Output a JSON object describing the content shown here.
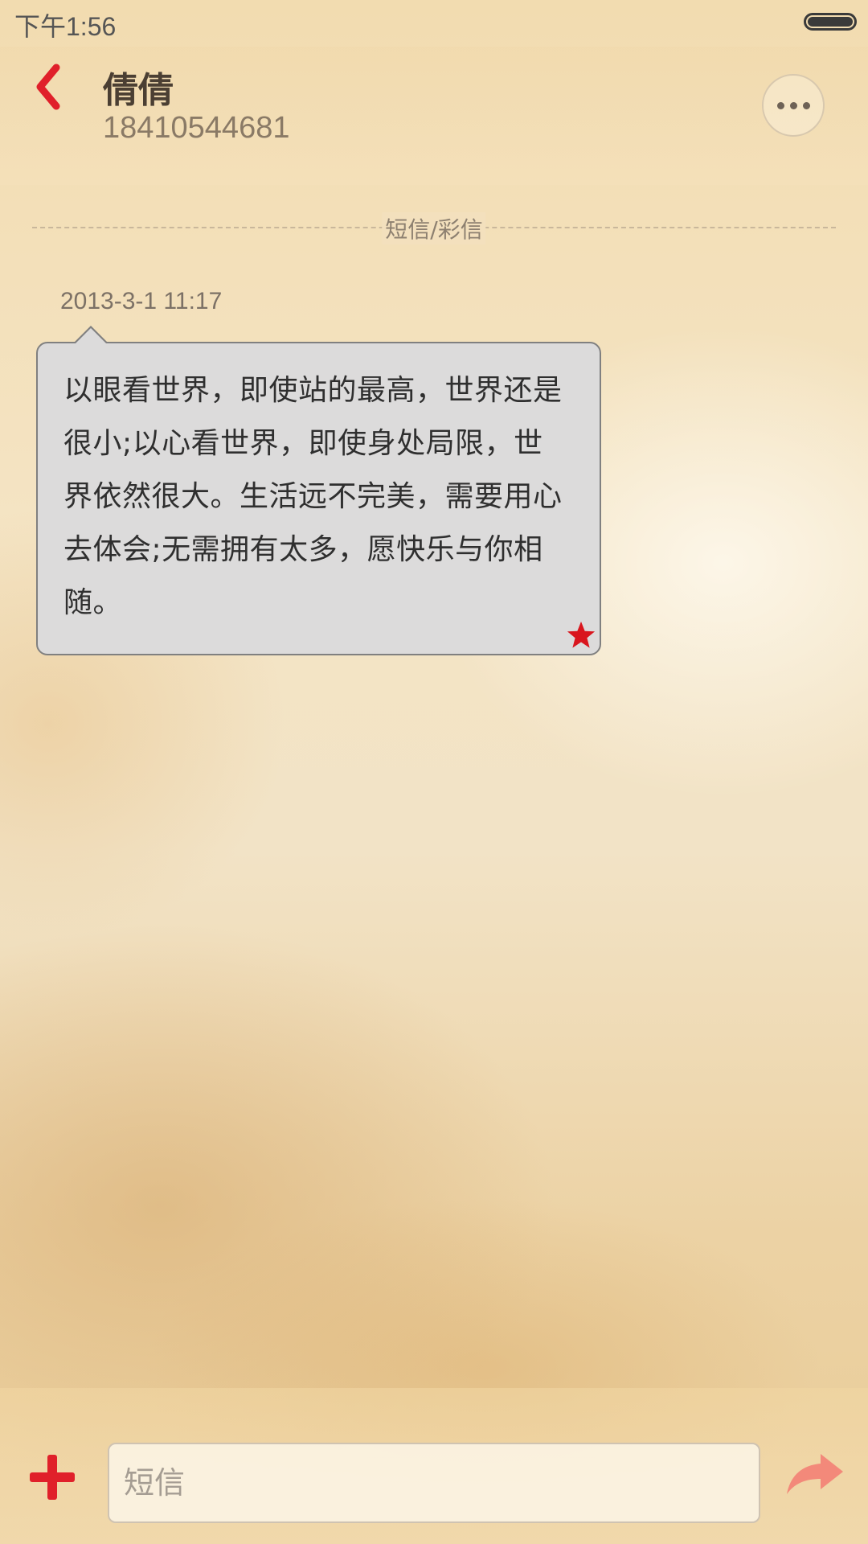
{
  "status_bar": {
    "time": "下午1:56"
  },
  "header": {
    "back_icon": "chevron-left-icon",
    "contact_name": "倩倩",
    "contact_number": "18410544681",
    "more_icon": "more-dots-icon"
  },
  "conversation": {
    "section_label": "短信/彩信",
    "messages": [
      {
        "timestamp": "2013-3-1 11:17",
        "text": "以眼看世界，即使站的最高，世界还是很小;以心看世界，即使身处局限，世界依然很大。生活远不完美，需要用心去体会;无需拥有太多，愿快乐与你相随。",
        "starred": true
      }
    ]
  },
  "input_bar": {
    "placeholder": "短信",
    "value": "",
    "add_icon": "plus-icon",
    "send_icon": "send-arrow-icon"
  },
  "colors": {
    "accent": "#e0202a",
    "send_icon": "#f3897a",
    "bubble_background": "#dcdbdb"
  }
}
